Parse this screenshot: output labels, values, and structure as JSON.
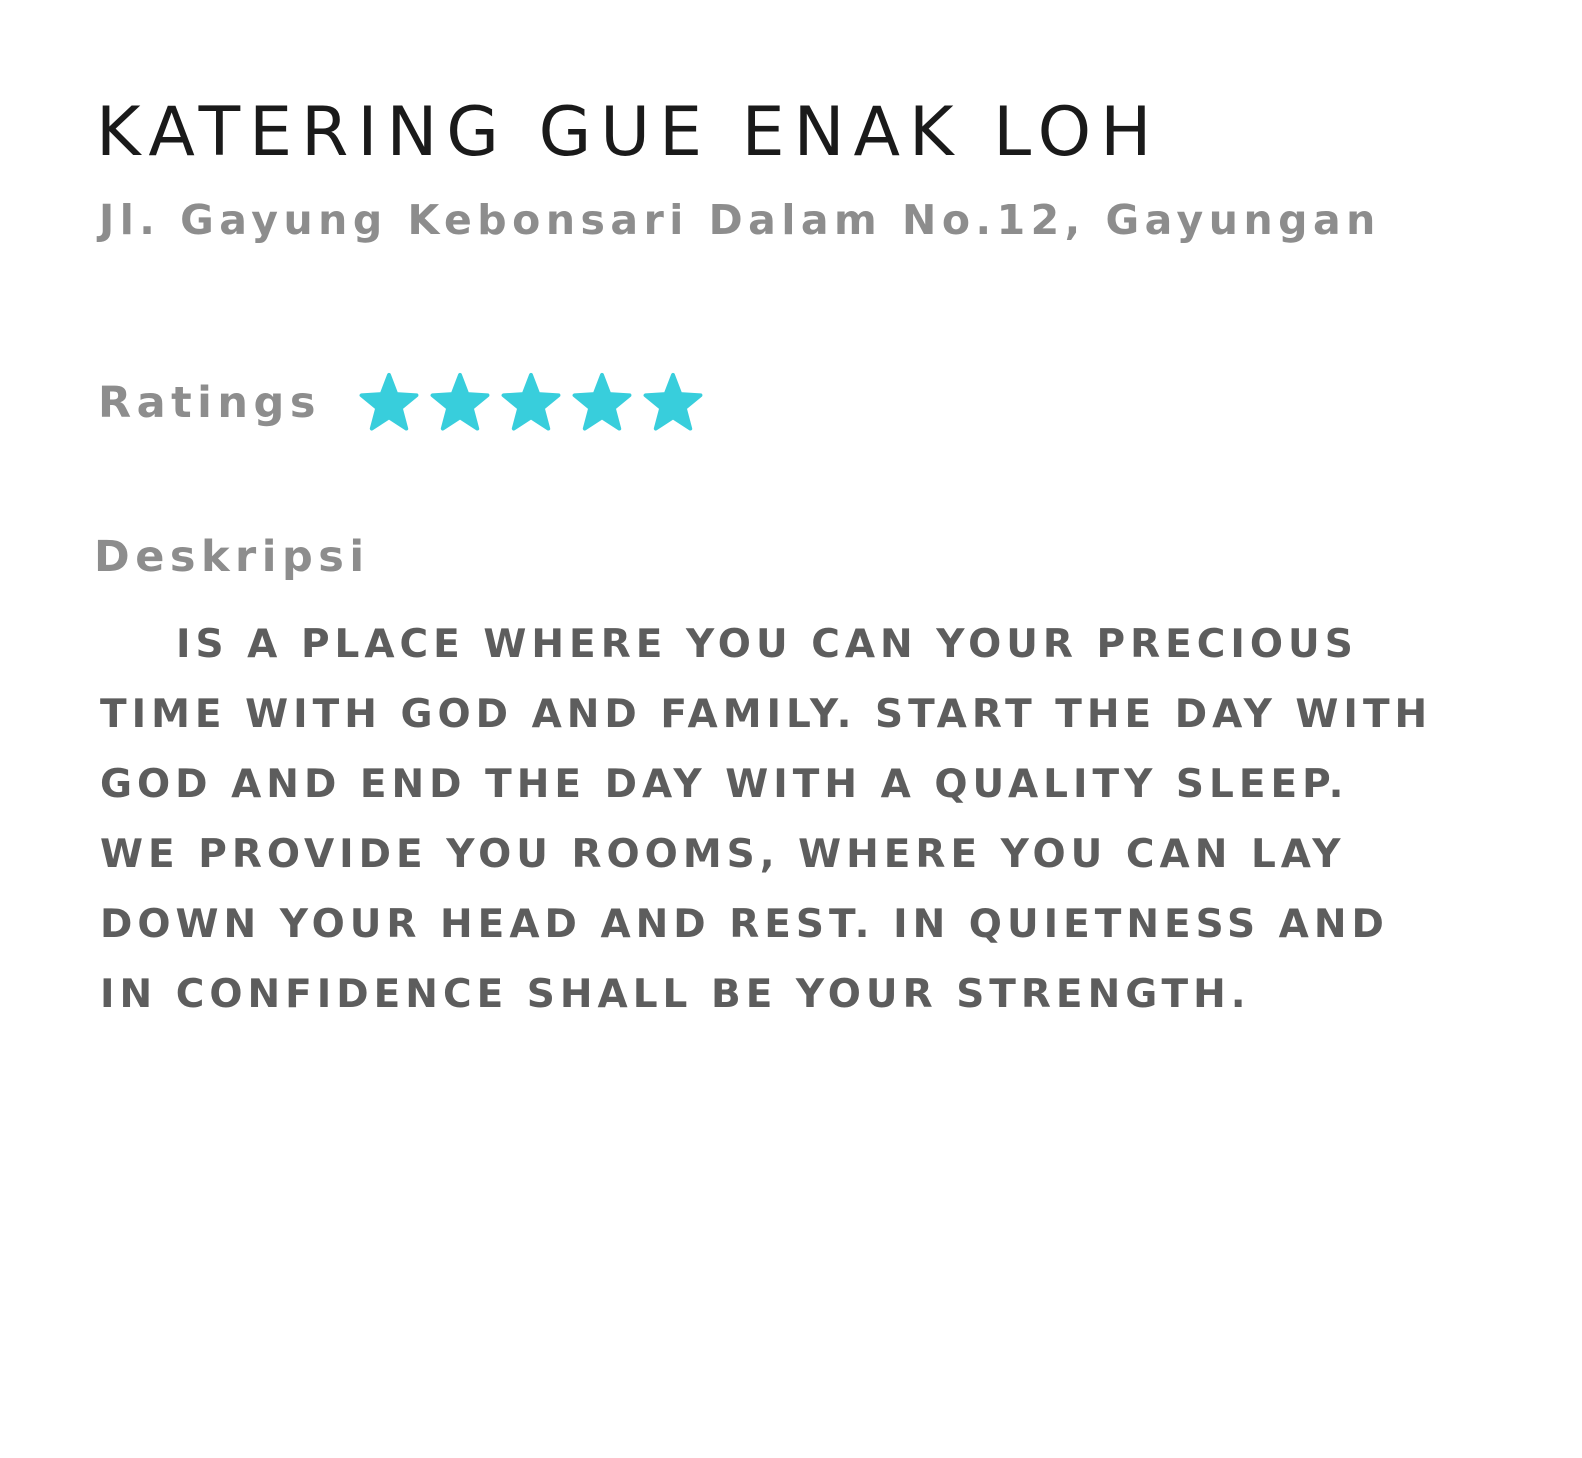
{
  "catering": {
    "name": "KATERING GUE ENAK LOH",
    "address": "Jl. Gayung Kebonsari Dalam No.12, Gayungan"
  },
  "ratings": {
    "label": "Ratings",
    "value": 5,
    "max": 5,
    "star_color": "#38CEDC"
  },
  "description": {
    "label": "Deskripsi",
    "text": "IS A PLACE WHERE YOU CAN YOUR PRECIOUS TIME WITH GOD AND FAMILY. START THE DAY WITH GOD AND END THE DAY WITH A QUALITY SLEEP. WE PROVIDE YOU ROOMS, WHERE YOU CAN LAY DOWN YOUR HEAD AND REST. IN QUIETNESS AND IN CONFIDENCE SHALL BE YOUR STRENGTH."
  }
}
